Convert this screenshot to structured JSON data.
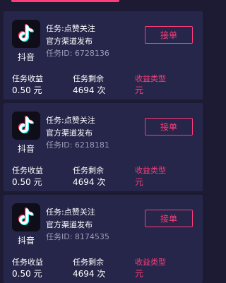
{
  "colors": {
    "background": "#1c1b33",
    "card": "#26264a",
    "accent": "#ff3b78",
    "muted": "#9c9cba"
  },
  "cards": [
    {
      "app_icon": "tiktok-icon",
      "app_name": "抖音",
      "task_title": "任务:点赞关注",
      "channel": "官方渠道发布",
      "task_id_label": "任务ID:",
      "task_id_value": "6728136",
      "button_label": "接单",
      "earnings_label": "任务收益",
      "earnings_value": "0.50 元",
      "remaining_label": "任务剩余",
      "remaining_value": "4694 次",
      "type_label": "收益类型",
      "type_value": "元"
    },
    {
      "app_icon": "tiktok-icon",
      "app_name": "抖音",
      "task_title": "任务:点赞关注",
      "channel": "官方渠道发布",
      "task_id_label": "任务ID:",
      "task_id_value": "6218181",
      "button_label": "接单",
      "earnings_label": "任务收益",
      "earnings_value": "0.50 元",
      "remaining_label": "任务剩余",
      "remaining_value": "4694 次",
      "type_label": "收益类型",
      "type_value": "元"
    },
    {
      "app_icon": "tiktok-icon",
      "app_name": "抖音",
      "task_title": "任务:点赞关注",
      "channel": "官方渠道发布",
      "task_id_label": "任务ID:",
      "task_id_value": "8174535",
      "button_label": "接单",
      "earnings_label": "任务收益",
      "earnings_value": "0.50 元",
      "remaining_label": "任务剩余",
      "remaining_value": "4694 次",
      "type_label": "收益类型",
      "type_value": "元"
    }
  ]
}
